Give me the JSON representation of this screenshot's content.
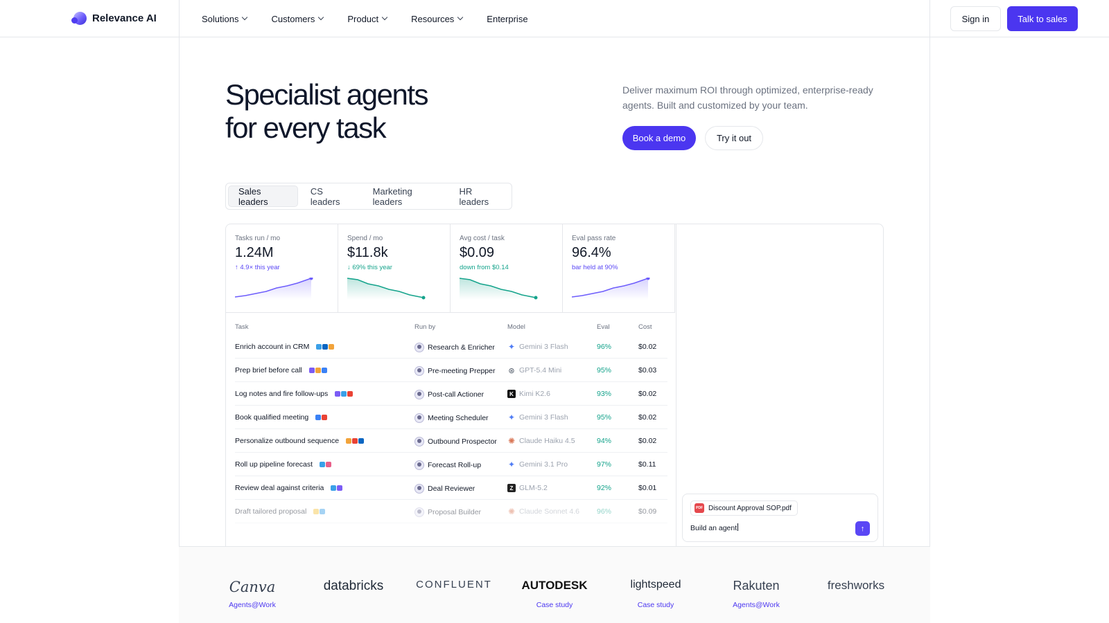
{
  "nav": {
    "brand": "Relevance AI",
    "menu": [
      {
        "label": "Solutions",
        "dropdown": true
      },
      {
        "label": "Customers",
        "dropdown": true
      },
      {
        "label": "Product",
        "dropdown": true
      },
      {
        "label": "Resources",
        "dropdown": true
      },
      {
        "label": "Enterprise",
        "dropdown": false
      }
    ],
    "sign_in": "Sign in",
    "cta": "Talk to sales"
  },
  "hero": {
    "title_line1": "Specialist agents",
    "title_line2": "for every task",
    "subtitle": "Deliver maximum ROI through optimized, enterprise-ready agents. Built and customized by your team.",
    "primary_button": "Book a demo",
    "secondary_button": "Try it out"
  },
  "tabs": [
    "Sales leaders",
    "CS leaders",
    "Marketing leaders",
    "HR leaders"
  ],
  "active_tab": "Sales leaders",
  "metrics": [
    {
      "label": "Tasks run / mo",
      "value": "1.24M",
      "delta": "↑ 4.9× this year",
      "delta_color": "#5a47f5",
      "trend": "up",
      "color": "#6d5dfc"
    },
    {
      "label": "Spend / mo",
      "value": "$11.8k",
      "delta": "↓ 69% this year",
      "delta_color": "#14a38b",
      "trend": "down",
      "color": "#14a38b"
    },
    {
      "label": "Avg cost / task",
      "value": "$0.09",
      "delta": "down from $0.14",
      "delta_color": "#14a38b",
      "trend": "down",
      "color": "#14a38b"
    },
    {
      "label": "Eval pass rate",
      "value": "96.4%",
      "delta": "bar held at 90%",
      "delta_color": "#5a47f5",
      "trend": "up",
      "color": "#6d5dfc"
    }
  ],
  "table": {
    "headers": {
      "task": "Task",
      "run_by": "Run by",
      "model": "Model",
      "eval": "Eval",
      "cost": "Cost"
    },
    "rows": [
      {
        "task": "Enrich account in CRM",
        "tools": [
          "#3aa0e8",
          "#0a66c2",
          "#f2a33a"
        ],
        "run_by": "Research & Enricher",
        "model": "Gemini 3 Flash",
        "model_icon": "gemini-icon",
        "eval": "96%",
        "cost": "$0.02"
      },
      {
        "task": "Prep brief before call",
        "tools": [
          "#7b5cf5",
          "#f2a33a",
          "#3b82f6"
        ],
        "run_by": "Pre-meeting Prepper",
        "model": "GPT-5.4 Mini",
        "model_icon": "openai-icon",
        "eval": "95%",
        "cost": "$0.03"
      },
      {
        "task": "Log notes and fire follow-ups",
        "tools": [
          "#7b5cf5",
          "#3aa0e8",
          "#ea4335"
        ],
        "run_by": "Post-call Actioner",
        "model": "Kimi K2.6",
        "model_icon": "kimi-icon",
        "eval": "93%",
        "cost": "$0.02"
      },
      {
        "task": "Book qualified meeting",
        "tools": [
          "#3b82f6",
          "#ea4335"
        ],
        "run_by": "Meeting Scheduler",
        "model": "Gemini 3 Flash",
        "model_icon": "gemini-icon",
        "eval": "95%",
        "cost": "$0.02"
      },
      {
        "task": "Personalize outbound sequence",
        "tools": [
          "#f2a33a",
          "#ea4335",
          "#0a66c2"
        ],
        "run_by": "Outbound Prospector",
        "model": "Claude Haiku 4.5",
        "model_icon": "claude-icon",
        "eval": "94%",
        "cost": "$0.02"
      },
      {
        "task": "Roll up pipeline forecast",
        "tools": [
          "#3aa0e8",
          "#e95f8a"
        ],
        "run_by": "Forecast Roll-up",
        "model": "Gemini 3.1 Pro",
        "model_icon": "gemini-icon",
        "eval": "97%",
        "cost": "$0.11"
      },
      {
        "task": "Review deal against criteria",
        "tools": [
          "#3aa0e8",
          "#7b5cf5"
        ],
        "run_by": "Deal Reviewer",
        "model": "GLM-5.2",
        "model_icon": "zhipu-icon",
        "eval": "92%",
        "cost": "$0.01"
      },
      {
        "task": "Draft tailored proposal",
        "tools": [
          "#f5c542",
          "#3aa0e8"
        ],
        "run_by": "Proposal Builder",
        "model": "Claude Sonnet 4.6",
        "model_icon": "claude-icon",
        "eval": "96%",
        "cost": "$0.09"
      }
    ]
  },
  "chat": {
    "attachment": "Discount Approval SOP.pdf",
    "pdf_badge": "PDF",
    "input_value": "Build an agent"
  },
  "logos": [
    {
      "name": "Canva",
      "link": "Agents@Work"
    },
    {
      "name": "databricks",
      "link": ""
    },
    {
      "name": "CONFLUENT",
      "link": ""
    },
    {
      "name": "AUTODESK",
      "link": "Case study"
    },
    {
      "name": "lightspeed",
      "link": "Case study"
    },
    {
      "name": "Rakuten",
      "link": "Agents@Work"
    },
    {
      "name": "freshworks",
      "link": ""
    }
  ],
  "colors": {
    "accent": "#4b36f0",
    "positive": "#14a38b",
    "border": "#e5e7eb"
  }
}
